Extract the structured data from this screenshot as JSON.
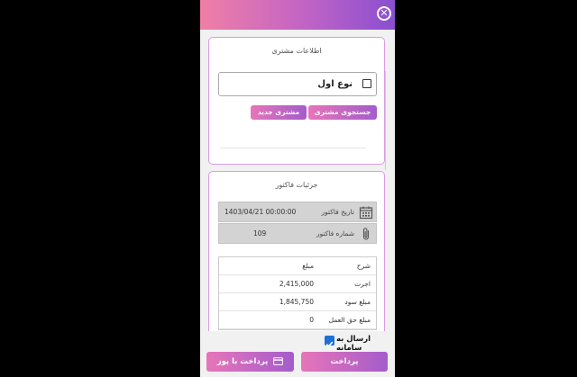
{
  "header": {
    "close_icon": "close-icon"
  },
  "customer": {
    "title": "اطلاعات مشتری",
    "type_label": "نوع اول",
    "search_button": "جستجوی مشتری",
    "new_button": "مشتری جدید"
  },
  "invoice": {
    "title": "جزئیات فاکتور",
    "date_label": "تاریخ فاکتور",
    "date_value": "1403/04/21  00:00:00",
    "number_label": "شماره فاکتور",
    "number_value": "109",
    "table": {
      "headers": [
        "شرح",
        "مبلغ"
      ],
      "rows": [
        [
          "اجرت",
          "2,415,000"
        ],
        [
          "مبلغ سود",
          "1,845,750"
        ],
        [
          "مبلغ حق العمل",
          "0"
        ]
      ]
    }
  },
  "footer": {
    "send_label": "ارسال به سامانه",
    "send_checked": true,
    "pay_button": "پرداخت",
    "pos_button": "پرداخت با پوز"
  },
  "colors": {
    "accent_start": "#e775b9",
    "accent_end": "#a45ccb",
    "border": "#d99be6",
    "checkbox": "#1e6fd9"
  }
}
